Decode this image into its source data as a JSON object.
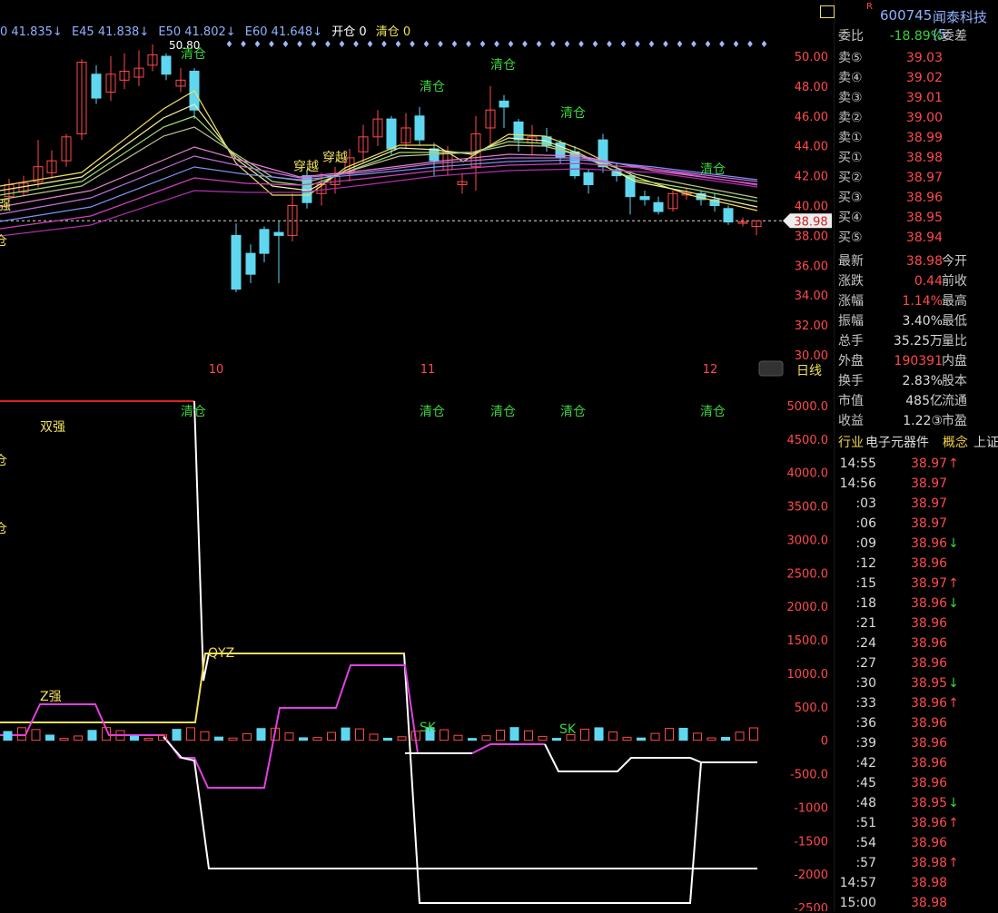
{
  "indicators": {
    "e_first": "0 41.835↓",
    "e45": "E45 41.838↓",
    "e50": "E50 41.802↓",
    "e60": "E60 41.648↓",
    "open_pos": "开仓 0",
    "clear_pos": "清仓 0"
  },
  "chart_labels": {
    "max_price_mark": "50.80",
    "clear": "清仓",
    "cross": "穿越",
    "double_strong": "双强",
    "strong_left": "强",
    "cang_left": "仓",
    "qyz": "QYZ",
    "zq": "Z强",
    "sk": "SK",
    "current_price_tag": "38.98",
    "daily": "日线"
  },
  "price_axis": [
    "50.00",
    "48.00",
    "46.00",
    "44.00",
    "42.00",
    "40.00",
    "38.00",
    "36.00",
    "34.00",
    "32.00",
    "30.00"
  ],
  "month_labels": [
    "10",
    "11",
    "12"
  ],
  "indicator_axis": [
    "5000.0",
    "4500.0",
    "4000.0",
    "3500.0",
    "3000.0",
    "2500.0",
    "2000.0",
    "1500.0",
    "1000.0",
    "500.0",
    "0",
    "-500.0",
    "-1000",
    "-1500",
    "-2000",
    "-2500"
  ],
  "colors": {
    "up": "#ff4a4a",
    "down": "#5fd7f0",
    "yellow": "#f0e05a",
    "magenta": "#e040e0",
    "green_label": "#3cd23c",
    "red_line": "#e02020",
    "white_line": "#ffffff"
  },
  "stock": {
    "code": "600745",
    "name": "闻泰科技(5",
    "r_badge": "R",
    "wb_label": "委比",
    "wb_value": "-18.89%",
    "wc_label": "委差"
  },
  "order_book": [
    {
      "label": "卖⑤",
      "price": "39.03",
      "side": "sell"
    },
    {
      "label": "卖④",
      "price": "39.02",
      "side": "sell"
    },
    {
      "label": "卖③",
      "price": "39.01",
      "side": "sell"
    },
    {
      "label": "卖②",
      "price": "39.00",
      "side": "sell"
    },
    {
      "label": "卖①",
      "price": "38.99",
      "side": "sell"
    },
    {
      "label": "买①",
      "price": "38.98",
      "side": "buy"
    },
    {
      "label": "买②",
      "price": "38.97",
      "side": "buy"
    },
    {
      "label": "买③",
      "price": "38.96",
      "side": "buy"
    },
    {
      "label": "买④",
      "price": "38.95",
      "side": "buy"
    },
    {
      "label": "买⑤",
      "price": "38.94",
      "side": "buy"
    }
  ],
  "stats": [
    {
      "l1": "最新",
      "v": "38.98",
      "vc": "r",
      "l2": "今开"
    },
    {
      "l1": "涨跌",
      "v": "0.44",
      "vc": "r",
      "l2": "前收"
    },
    {
      "l1": "涨幅",
      "v": "1.14%",
      "vc": "r",
      "l2": "最高"
    },
    {
      "l1": "振幅",
      "v": "3.40%",
      "vc": "w",
      "l2": "最低"
    },
    {
      "l1": "总手",
      "v": "35.25万",
      "vc": "w",
      "l2": "量比"
    },
    {
      "l1": "外盘",
      "v": "190391",
      "vc": "r",
      "l2": "内盘"
    },
    {
      "l1": "换手",
      "v": "2.83%",
      "vc": "w",
      "l2": "股本"
    },
    {
      "l1": "市值",
      "v": "485亿",
      "vc": "w",
      "l2": "流通"
    },
    {
      "l1": "收益",
      "v": "1.22③",
      "vc": "w",
      "l2": "市盈"
    }
  ],
  "industry": {
    "label": "行业",
    "value": "电子元器件",
    "concept_label": "概念",
    "concept_value": "上证"
  },
  "ticks": [
    {
      "t": "14:55",
      "p": "38.97",
      "a": "↑",
      "ac": "r"
    },
    {
      "t": "14:56",
      "p": "38.97",
      "a": "",
      "ac": ""
    },
    {
      "t": ":03",
      "p": "38.97",
      "a": "",
      "ac": ""
    },
    {
      "t": ":06",
      "p": "38.97",
      "a": "",
      "ac": ""
    },
    {
      "t": ":09",
      "p": "38.96",
      "a": "↓",
      "ac": "g"
    },
    {
      "t": ":12",
      "p": "38.96",
      "a": "",
      "ac": ""
    },
    {
      "t": ":15",
      "p": "38.97",
      "a": "↑",
      "ac": "r"
    },
    {
      "t": ":18",
      "p": "38.96",
      "a": "↓",
      "ac": "g"
    },
    {
      "t": ":21",
      "p": "38.96",
      "a": "",
      "ac": ""
    },
    {
      "t": ":24",
      "p": "38.96",
      "a": "",
      "ac": ""
    },
    {
      "t": ":27",
      "p": "38.96",
      "a": "",
      "ac": ""
    },
    {
      "t": ":30",
      "p": "38.95",
      "a": "↓",
      "ac": "g"
    },
    {
      "t": ":33",
      "p": "38.96",
      "a": "↑",
      "ac": "r"
    },
    {
      "t": ":36",
      "p": "38.96",
      "a": "",
      "ac": ""
    },
    {
      "t": ":39",
      "p": "38.96",
      "a": "",
      "ac": ""
    },
    {
      "t": ":42",
      "p": "38.96",
      "a": "",
      "ac": ""
    },
    {
      "t": ":45",
      "p": "38.96",
      "a": "",
      "ac": ""
    },
    {
      "t": ":48",
      "p": "38.95",
      "a": "↓",
      "ac": "g"
    },
    {
      "t": ":51",
      "p": "38.96",
      "a": "↑",
      "ac": "r"
    },
    {
      "t": ":54",
      "p": "38.96",
      "a": "",
      "ac": ""
    },
    {
      "t": ":57",
      "p": "38.98",
      "a": "↑",
      "ac": "r"
    },
    {
      "t": "14:57",
      "p": "38.98",
      "a": "",
      "ac": ""
    },
    {
      "t": "15:00",
      "p": "38.98",
      "a": "",
      "ac": ""
    }
  ]
}
